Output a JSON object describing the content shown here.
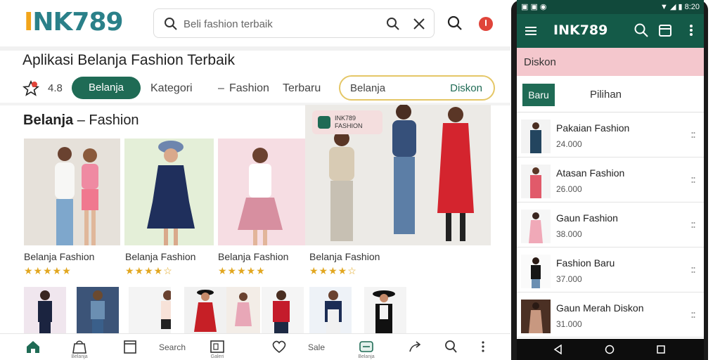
{
  "header": {
    "logo_first": "I",
    "logo_rest": "NK789",
    "search_placeholder": "Beli fashion terbaik"
  },
  "app_title": "Aplikasi Belanja Fashion Terbaik",
  "chips": {
    "rating": "4.8",
    "primary": "Belanja",
    "links": [
      "Kategori",
      "Fashion",
      "Terbaru"
    ],
    "outline_left": "Belanja",
    "outline_right": "Diskon"
  },
  "section": {
    "bold": "Belanja",
    "dash": "–",
    "rest": "Fashion"
  },
  "products": [
    {
      "name": "Belanja Fashion",
      "stars": "★★★★★",
      "count": "",
      "colors": [
        "#e6e1da",
        "#d8d2ca"
      ]
    },
    {
      "name": "Belanja Fashion",
      "stars": "★★★★☆",
      "count": "",
      "colors": [
        "#e4efd8",
        "#d7e6c6"
      ]
    },
    {
      "name": "Belanja Fashion",
      "stars": "★★★★★",
      "count": "",
      "colors": [
        "#f6dde3",
        "#efcfd8"
      ]
    },
    {
      "name": "Belanja Fashion",
      "stars": "★★★★☆",
      "count": "",
      "colors": [
        "#eceae6",
        "#e2dfda"
      ]
    }
  ],
  "banner": {
    "tag_line1": "INK789",
    "tag_line2": "FASHION"
  },
  "thumbs": [
    {
      "bg": "#f0e6ee",
      "top": "#1b2440",
      "bottom": "#1b2440"
    },
    {
      "bg": "#3c5478",
      "top": "#6b8fb2",
      "bottom": "#3a5f8a"
    },
    {
      "bg": "#f4f4f4",
      "top": "#f7e2d8",
      "bottom": "#222"
    },
    {
      "bg": "#f1f1f1",
      "top": "#c61f26",
      "bottom": "#c61f26"
    },
    {
      "bg": "#f3ede7",
      "top": "#e8a7b7",
      "bottom": "#e8a7b7"
    },
    {
      "bg": "#f5f5f5",
      "top": "#c41c2b",
      "bottom": "#1d2a44"
    },
    {
      "bg": "#eef2f7",
      "top": "#1c2d55",
      "bottom": "#f1f1f1"
    },
    {
      "bg": "#f4f4f4",
      "top": "#111",
      "bottom": "#111"
    }
  ],
  "bottom_nav": {
    "items": [
      {
        "icon": "home-icon",
        "label": ""
      },
      {
        "icon": "bag-icon",
        "label": "Belanja"
      },
      {
        "icon": "cart-icon",
        "label": ""
      },
      {
        "icon": "gallery-icon",
        "label": "Galeri"
      },
      {
        "icon": "heart-icon",
        "label": ""
      },
      {
        "icon": "card-icon",
        "label": "Belanja"
      },
      {
        "icon": "share-icon",
        "label": ""
      },
      {
        "icon": "search-icon",
        "label": ""
      },
      {
        "icon": "more-icon",
        "label": ""
      }
    ],
    "text1": "Search",
    "text2": "Sale"
  },
  "phone": {
    "status_left": "▣ ▣ ◉",
    "status_right": "▼ ◢ ▮ 8:20",
    "title": "INK789",
    "banner": "Diskon",
    "seg_button": "Baru",
    "seg_link": "Pilihan",
    "items": [
      {
        "name": "Pakaian Fashion",
        "price": "24.000",
        "colors": [
          "#f3f3f3",
          "#23455f"
        ]
      },
      {
        "name": "Atasan Fashion",
        "price": "26.000",
        "colors": [
          "#f4f4f4",
          "#e15a6a"
        ]
      },
      {
        "name": "Gaun Fashion",
        "price": "38.000",
        "colors": [
          "#f6f6f6",
          "#f0a9b8"
        ]
      },
      {
        "name": "Fashion Baru",
        "price": "37.000",
        "colors": [
          "#fafafa",
          "#161616"
        ]
      },
      {
        "name": "Gaun Merah Diskon",
        "price": "31.000",
        "colors": [
          "#4b3024",
          "#c89880"
        ]
      }
    ]
  }
}
